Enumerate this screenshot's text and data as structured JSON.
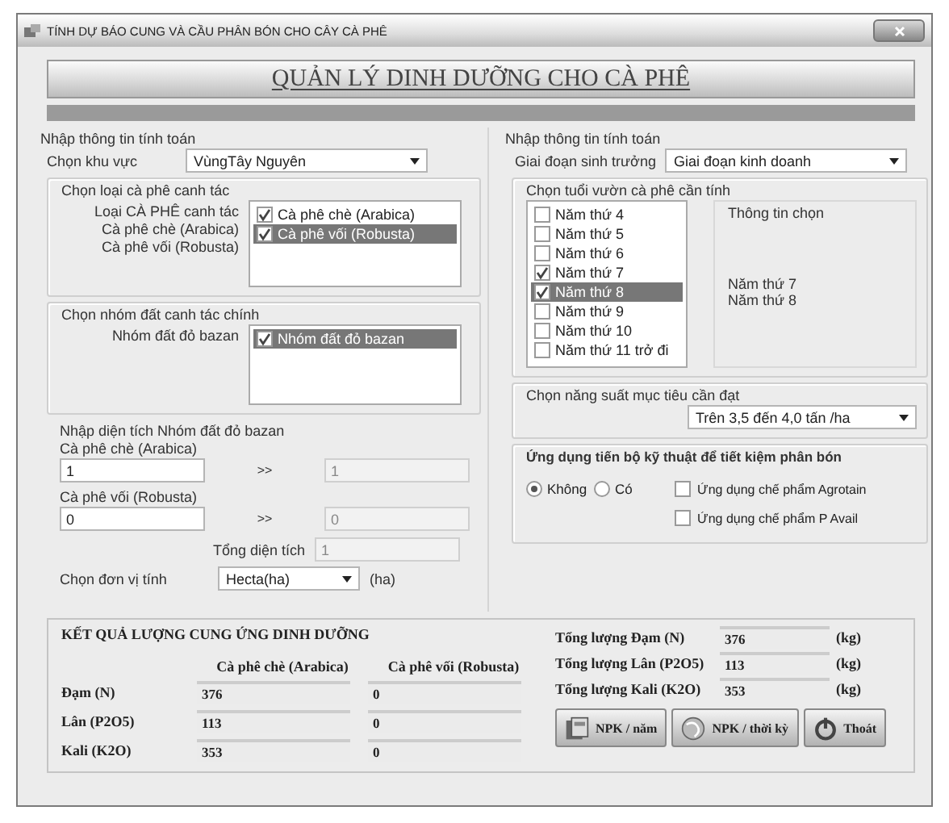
{
  "window": {
    "title": "TÍNH DỰ BÁO CUNG VÀ CẦU PHÂN BÓN CHO CÂY CÀ PHÊ"
  },
  "header": {
    "title": "QUẢN LÝ DINH DƯỠNG CHO CÀ PHÊ"
  },
  "left": {
    "group_title": "Nhập thông tin tính toán",
    "region": {
      "label": "Chọn khu vực",
      "value": "VùngTây Nguyên"
    },
    "coffee_type": {
      "title": "Chọn loại cà phê canh tác",
      "labels": [
        "Loại CÀ PHÊ canh tác",
        "Cà phê chè (Arabica)",
        "Cà phê vối (Robusta)"
      ],
      "items": [
        {
          "label": "Cà phê chè (Arabica)",
          "checked": true,
          "selected": false
        },
        {
          "label": "Cà phê vối (Robusta)",
          "checked": true,
          "selected": true
        }
      ]
    },
    "soil": {
      "title": "Chọn nhóm đất canh tác chính",
      "labels": [
        "Nhóm đất đỏ bazan"
      ],
      "items": [
        {
          "label": "Nhóm đất đỏ bazan",
          "checked": true,
          "selected": true
        }
      ]
    },
    "area": {
      "title": "Nhập diện tích Nhóm đất đỏ bazan",
      "rows": [
        {
          "label": "Cà phê chè (Arabica)",
          "value": "1",
          "arrow": ">>",
          "result": "1"
        },
        {
          "label": "Cà phê vối (Robusta)",
          "value": "0",
          "arrow": ">>",
          "result": "0"
        }
      ],
      "total_label": "Tổng diện tích",
      "total": "1",
      "unit_label": "Chọn đơn vị tính",
      "unit": "Hecta(ha)",
      "unit_suffix": "(ha)"
    }
  },
  "right": {
    "group_title": "Nhập thông tin tính toán",
    "stage": {
      "label": "Giai đoạn sinh trưởng",
      "value": "Giai đoạn kinh doanh"
    },
    "age": {
      "title": "Chọn tuổi vườn cà phê cần tính",
      "items": [
        {
          "label": "Năm thứ 4",
          "checked": false,
          "selected": false
        },
        {
          "label": "Năm thứ 5",
          "checked": false,
          "selected": false
        },
        {
          "label": "Năm thứ 6",
          "checked": false,
          "selected": false
        },
        {
          "label": "Năm thứ 7",
          "checked": true,
          "selected": false
        },
        {
          "label": "Năm thứ 8",
          "checked": true,
          "selected": true
        },
        {
          "label": "Năm thứ 9",
          "checked": false,
          "selected": false
        },
        {
          "label": "Năm thứ 10",
          "checked": false,
          "selected": false
        },
        {
          "label": "Năm thứ 11 trở đi",
          "checked": false,
          "selected": false
        }
      ],
      "info_title": "Thông tin chọn",
      "info_lines": [
        "Năm thứ 7",
        "Năm thứ 8"
      ]
    },
    "yield": {
      "title": "Chọn năng suất mục tiêu cần đạt",
      "value": "Trên 3,5 đến 4,0 tấn /ha"
    },
    "tech": {
      "title": "Ứng dụng tiến bộ kỹ thuật để tiết kiệm phân bón",
      "radios": [
        {
          "label": "Không",
          "selected": true
        },
        {
          "label": "Có",
          "selected": false
        }
      ],
      "checks": [
        {
          "label": "Ứng dụng chế phẩm Agrotain",
          "checked": false
        },
        {
          "label": "Ứng dụng chế phẩm P Avail",
          "checked": false
        }
      ]
    }
  },
  "results": {
    "title": "KẾT QUẢ LƯỢNG CUNG ỨNG DINH DƯỠNG",
    "columns": [
      "Cà phê chè (Arabica)",
      "Cà phê vối (Robusta)"
    ],
    "rows": [
      {
        "label": "Đạm (N)",
        "values": [
          "376",
          "0"
        ]
      },
      {
        "label": "Lân (P2O5)",
        "values": [
          "113",
          "0"
        ]
      },
      {
        "label": "Kali (K2O)",
        "values": [
          "353",
          "0"
        ]
      }
    ],
    "totals": [
      {
        "label": "Tổng lượng Đạm (N)",
        "value": "376",
        "unit": "(kg)"
      },
      {
        "label": "Tổng lượng Lân (P2O5)",
        "value": "113",
        "unit": "(kg)"
      },
      {
        "label": "Tổng lượng Kali (K2O)",
        "value": "353",
        "unit": "(kg)"
      }
    ],
    "buttons": [
      {
        "label": "NPK / năm",
        "kind": "book"
      },
      {
        "label": "NPK / thời kỳ",
        "kind": "globe"
      },
      {
        "label": "Thoát",
        "kind": "power"
      }
    ]
  }
}
